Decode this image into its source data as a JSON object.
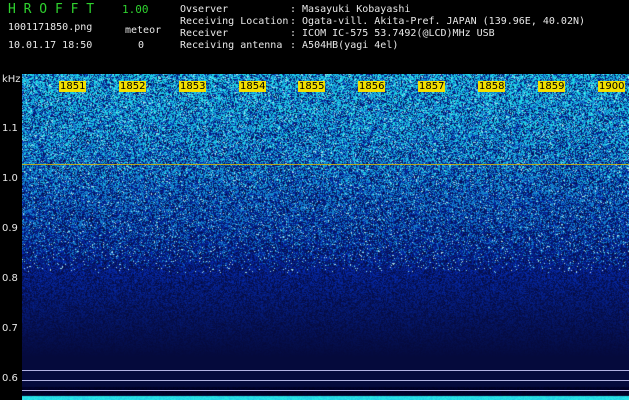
{
  "app": {
    "title": "H R O F F T",
    "version": "1.00"
  },
  "file": {
    "name": "1001171850.png",
    "datetime": "10.01.17 18:50"
  },
  "meteor": {
    "label": "meteor",
    "count": "0"
  },
  "info": [
    {
      "key": "Ovserver",
      "value": ": Masayuki Kobayashi"
    },
    {
      "key": "Receiving Location",
      "value": ": Ogata-vill. Akita-Pref. JAPAN (139.96E, 40.02N)"
    },
    {
      "key": "Receiver",
      "value": ": ICOM IC-575 53.7492(@LCD)MHz USB"
    },
    {
      "key": "Receiving antenna",
      "value": ": A504HB(yagi 4el)"
    }
  ],
  "yaxis": {
    "unit": "kHz",
    "ticks": [
      {
        "label": "1.1",
        "value": 1.1
      },
      {
        "label": "1.0",
        "value": 1.0
      },
      {
        "label": "0.9",
        "value": 0.9
      },
      {
        "label": "0.8",
        "value": 0.8
      },
      {
        "label": "0.7",
        "value": 0.7
      },
      {
        "label": "0.6",
        "value": 0.6
      }
    ]
  },
  "time_labels": [
    "1851",
    "1852",
    "1853",
    "1854",
    "1855",
    "1856",
    "1857",
    "1858",
    "1859",
    "1900"
  ],
  "colors": {
    "accent": "#2fd22f",
    "timeLabelBg": "#f2e000",
    "carrierLine": "#e0c000",
    "refLine": "#c0c0ff"
  }
}
